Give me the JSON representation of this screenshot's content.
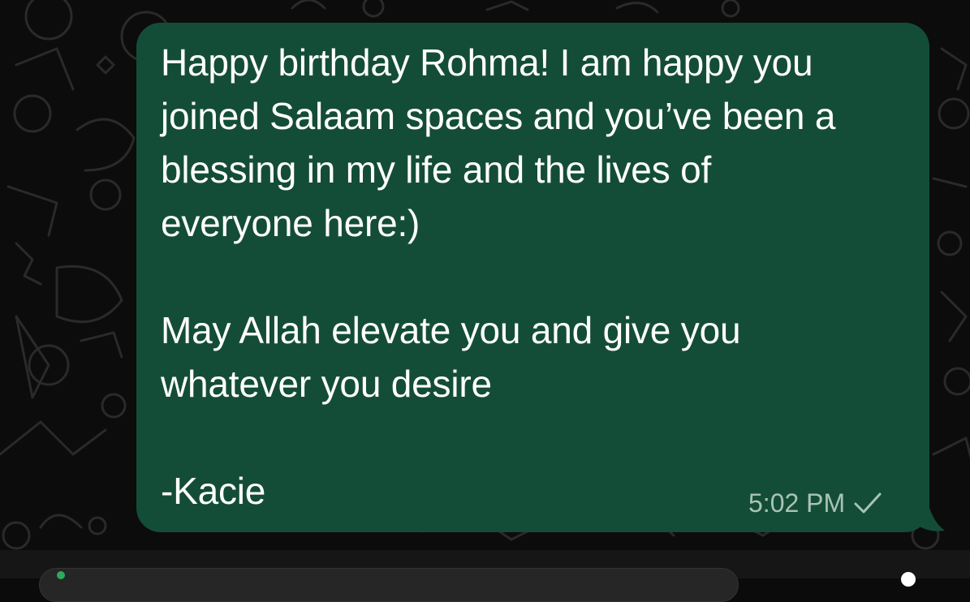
{
  "message": {
    "lines": [
      "Happy birthday Rohma! I am happy you",
      "joined Salaam spaces and you’ve been a",
      "blessing in my life and the lives of",
      "everyone here:)",
      "",
      "May Allah elevate you and give you",
      "whatever you desire",
      "",
      "-Kacie"
    ],
    "time": "5:02 PM",
    "status_icon": "single-check-icon"
  },
  "colors": {
    "bubble": "#144d37",
    "background": "#0c0c0c",
    "text": "#ffffff",
    "meta": "#a9c3b7"
  }
}
